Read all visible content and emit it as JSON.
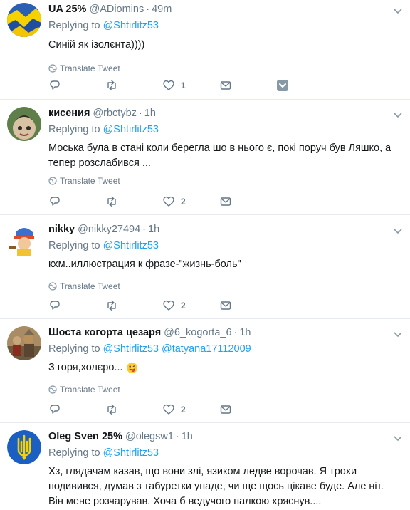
{
  "tweets": [
    {
      "name": "UA 25%",
      "handle": "@ADiomins",
      "time": "49m",
      "replying_prefix": "Replying to",
      "mention1": "@Shtirlitz53",
      "mention2": "",
      "text": "Синій як ізолєнта))))",
      "translate": "Translate Tweet",
      "likes": "1"
    },
    {
      "name": "кисения",
      "handle": "@rbctybz",
      "time": "1h",
      "replying_prefix": "Replying to",
      "mention1": "@Shtirlitz53",
      "mention2": "",
      "text": "Моська була в стані коли берегла шо в нього є, покі поруч був Ляшко, а тепер розслабився ...",
      "translate": "Translate Tweet",
      "likes": "2"
    },
    {
      "name": "nikky",
      "handle": "@nikky27494",
      "time": "1h",
      "replying_prefix": "Replying to",
      "mention1": "@Shtirlitz53",
      "mention2": "",
      "text": "кхм..иллюстрация к фразе-\"жизнь-боль\"",
      "translate": "Translate Tweet",
      "likes": "2"
    },
    {
      "name": "Шоста когорта цезаря",
      "handle": "@6_kogorta_6",
      "time": "1h",
      "replying_prefix": "Replying to",
      "mention1": "@Shtirlitz53",
      "mention2": "@tatyana17112009",
      "text": "З горя,холєро...",
      "translate": "Translate Tweet",
      "likes": "2"
    },
    {
      "name": "Oleg Sven 25%",
      "handle": "@olegsw1",
      "time": "1h",
      "replying_prefix": "Replying to",
      "mention1": "@Shtirlitz53",
      "mention2": "",
      "text": "Хз, глядачам казав, що вони злі, язиком ледве ворочав. Я трохи подивився, думав з табуретки упаде, чи ще щось цікаве буде. Але ніт. Він мене розчарував. Хоча б ведучого палкою хряснув....",
      "translate": "",
      "likes": ""
    }
  ],
  "icons": {
    "reply": "reply-icon",
    "retweet": "retweet-icon",
    "like": "heart-icon",
    "dm": "envelope-icon",
    "more": "caret-down-icon",
    "globe": "globe-icon"
  },
  "colors": {
    "link": "#1da1f2",
    "muted": "#657786",
    "text": "#14171a",
    "border": "#e6ecf0"
  }
}
